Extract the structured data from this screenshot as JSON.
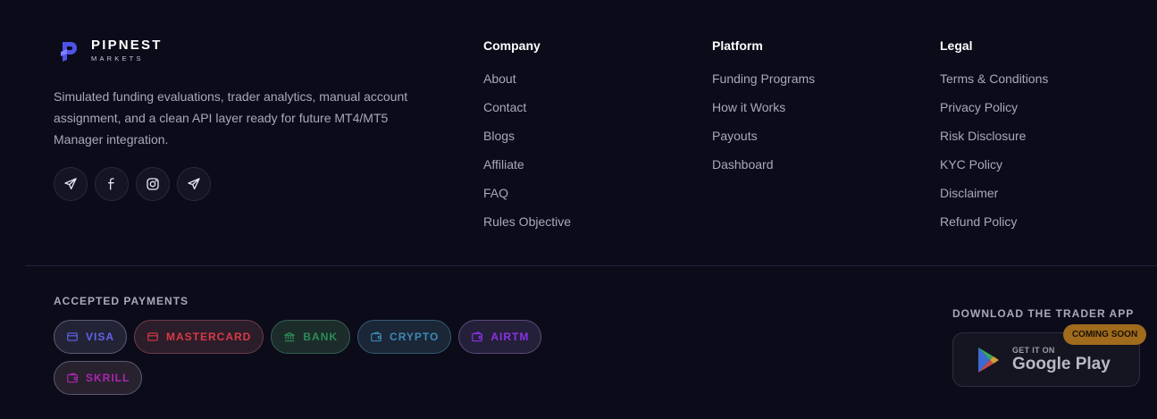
{
  "brand": {
    "name": "PIPNEST",
    "sub": "MARKETS"
  },
  "about": "Simulated funding evaluations, trader analytics, manual account assignment, and a clean API layer ready for future MT4/MT5 Manager integration.",
  "socials": [
    {
      "icon": "telegram-icon"
    },
    {
      "icon": "facebook-icon"
    },
    {
      "icon": "instagram-icon"
    },
    {
      "icon": "telegram-icon"
    }
  ],
  "columns": {
    "company": {
      "title": "Company",
      "links": [
        "About",
        "Contact",
        "Blogs",
        "Affiliate",
        "FAQ",
        "Rules Objective"
      ]
    },
    "platform": {
      "title": "Platform",
      "links": [
        "Funding Programs",
        "How it Works",
        "Payouts",
        "Dashboard"
      ]
    },
    "legal": {
      "title": "Legal",
      "links": [
        "Terms & Conditions",
        "Privacy Policy",
        "Risk Disclosure",
        "KYC Policy",
        "Disclaimer",
        "Refund Policy"
      ]
    }
  },
  "payments": {
    "title": "ACCEPTED PAYMENTS",
    "items": [
      {
        "label": "VISA",
        "icon": "card-icon",
        "color": "#6163ee",
        "border": "#5c5c74",
        "bg": "#232336"
      },
      {
        "label": "MASTERCARD",
        "icon": "card-icon",
        "color": "#d83a46",
        "border": "#6e3c48",
        "bg": "#2c1d2a"
      },
      {
        "label": "BANK",
        "icon": "bank-icon",
        "color": "#2c8c57",
        "border": "#35604f",
        "bg": "#1c2c2a"
      },
      {
        "label": "CRYPTO",
        "icon": "wallet-icon",
        "color": "#3d88b4",
        "border": "#345a72",
        "bg": "#1b2636"
      },
      {
        "label": "AIRTM",
        "icon": "wallet-icon",
        "color": "#8a32e6",
        "border": "#5c4a78",
        "bg": "#25203a"
      },
      {
        "label": "SKRILL",
        "icon": "wallet-icon",
        "color": "#b024b0",
        "border": "#5a5a70",
        "bg": "#27222e"
      }
    ]
  },
  "app": {
    "title": "DOWNLOAD THE TRADER APP",
    "store_small": "GET IT ON",
    "store_big": "Google Play",
    "badge": "COMING SOON"
  },
  "colors": {
    "background": "#0b0b1a",
    "accent": "#5558ef",
    "soon_badge": "#a06b1c"
  }
}
